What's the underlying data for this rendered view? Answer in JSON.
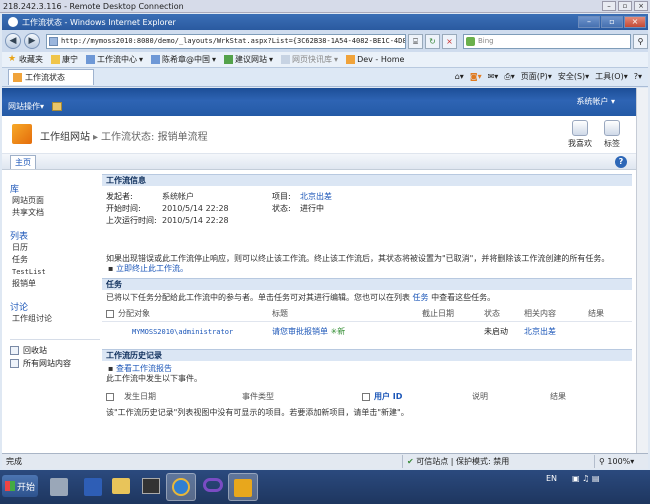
{
  "rdp": {
    "title": "218.242.3.116 - Remote Desktop Connection"
  },
  "ie": {
    "title": "工作流状态 - Windows Internet Explorer",
    "url": "http://mymoss2010:8080/demo/_layouts/WrkStat.aspx?List={3C62B38-1A54-4082-BE1C-4D8BEB7345C",
    "search_placeholder": "Bing",
    "favorites": [
      "收藏夹",
      "康宁",
      "工作流中心",
      "陈希章@中国",
      "建议网站",
      "网页快讯库",
      "Dev - Home"
    ],
    "tab_title": "工作流状态",
    "commands": [
      "页面(P)",
      "安全(S)",
      "工具(O)"
    ]
  },
  "sp": {
    "site_actions": "网站操作",
    "user": "系统帐户",
    "breadcrumb": {
      "site": "工作组网站",
      "page": "工作流状态: 报销单流程"
    },
    "header_buttons": {
      "like": "我喜欢",
      "tag": "标签"
    },
    "tab_home": "主页",
    "help": "?"
  },
  "quicklaunch": {
    "lib_heading": "库",
    "lib_items": [
      "网站页面",
      "共享文档"
    ],
    "list_heading": "列表",
    "list_items": [
      "日历",
      "任务",
      "TestList",
      "报销单"
    ],
    "disc_heading": "讨论",
    "disc_items": [
      "工作组讨论"
    ],
    "bottom": [
      "回收站",
      "所有网站内容"
    ]
  },
  "workflow_info": {
    "heading": "工作流信息",
    "initiator_label": "发起者:",
    "initiator": "系统帐户",
    "item_label": "项目:",
    "item": "北京出差",
    "start_label": "开始时间:",
    "start": "2010/5/14 22:28",
    "status_label": "状态:",
    "status": "进行中",
    "last_label": "上次运行时间:",
    "last": "2010/5/14 22:28",
    "note": "如果出现错误或此工作流停止响应，则可以终止该工作流。终止该工作流后，其状态将被设置为\"已取消\"，并将删除该工作流创建的所有任务。",
    "terminate_link": "立即终止此工作流。"
  },
  "tasks": {
    "heading": "任务",
    "desc_pre": "已将以下任务分配给此工作流中的参与者。单击任务可对其进行编辑。您也可以在列表",
    "desc_link": "任务",
    "desc_post": "中查看这些任务。",
    "columns": [
      "分配对象",
      "标题",
      "截止日期",
      "状态",
      "相关内容",
      "结果"
    ],
    "rows": [
      {
        "assigned": "MYMOSS2010\\administrator",
        "title": "请您审批报销单",
        "badge": "新",
        "due": "",
        "status": "未启动",
        "related": "北京出差",
        "result": ""
      }
    ]
  },
  "history": {
    "heading": "工作流历史记录",
    "report_link": "查看工作流报告",
    "desc": "此工作流中发生以下事件。",
    "columns": [
      "发生日期",
      "事件类型",
      "用户 ID",
      "说明",
      "结果"
    ],
    "footer": "该\"工作流历史记录\"列表视图中没有可显示的项目。若要添加新项目，请单击\"新建\"。"
  },
  "statusbar": {
    "left": "完成",
    "zone": "可信站点 | 保护模式: 禁用",
    "zoom": "100%"
  },
  "taskbar": {
    "start": "开始",
    "lang": "EN"
  },
  "colors": {
    "sp_blue": "#245aa6",
    "link": "#1b56b8",
    "section": "#dbe6f4"
  }
}
